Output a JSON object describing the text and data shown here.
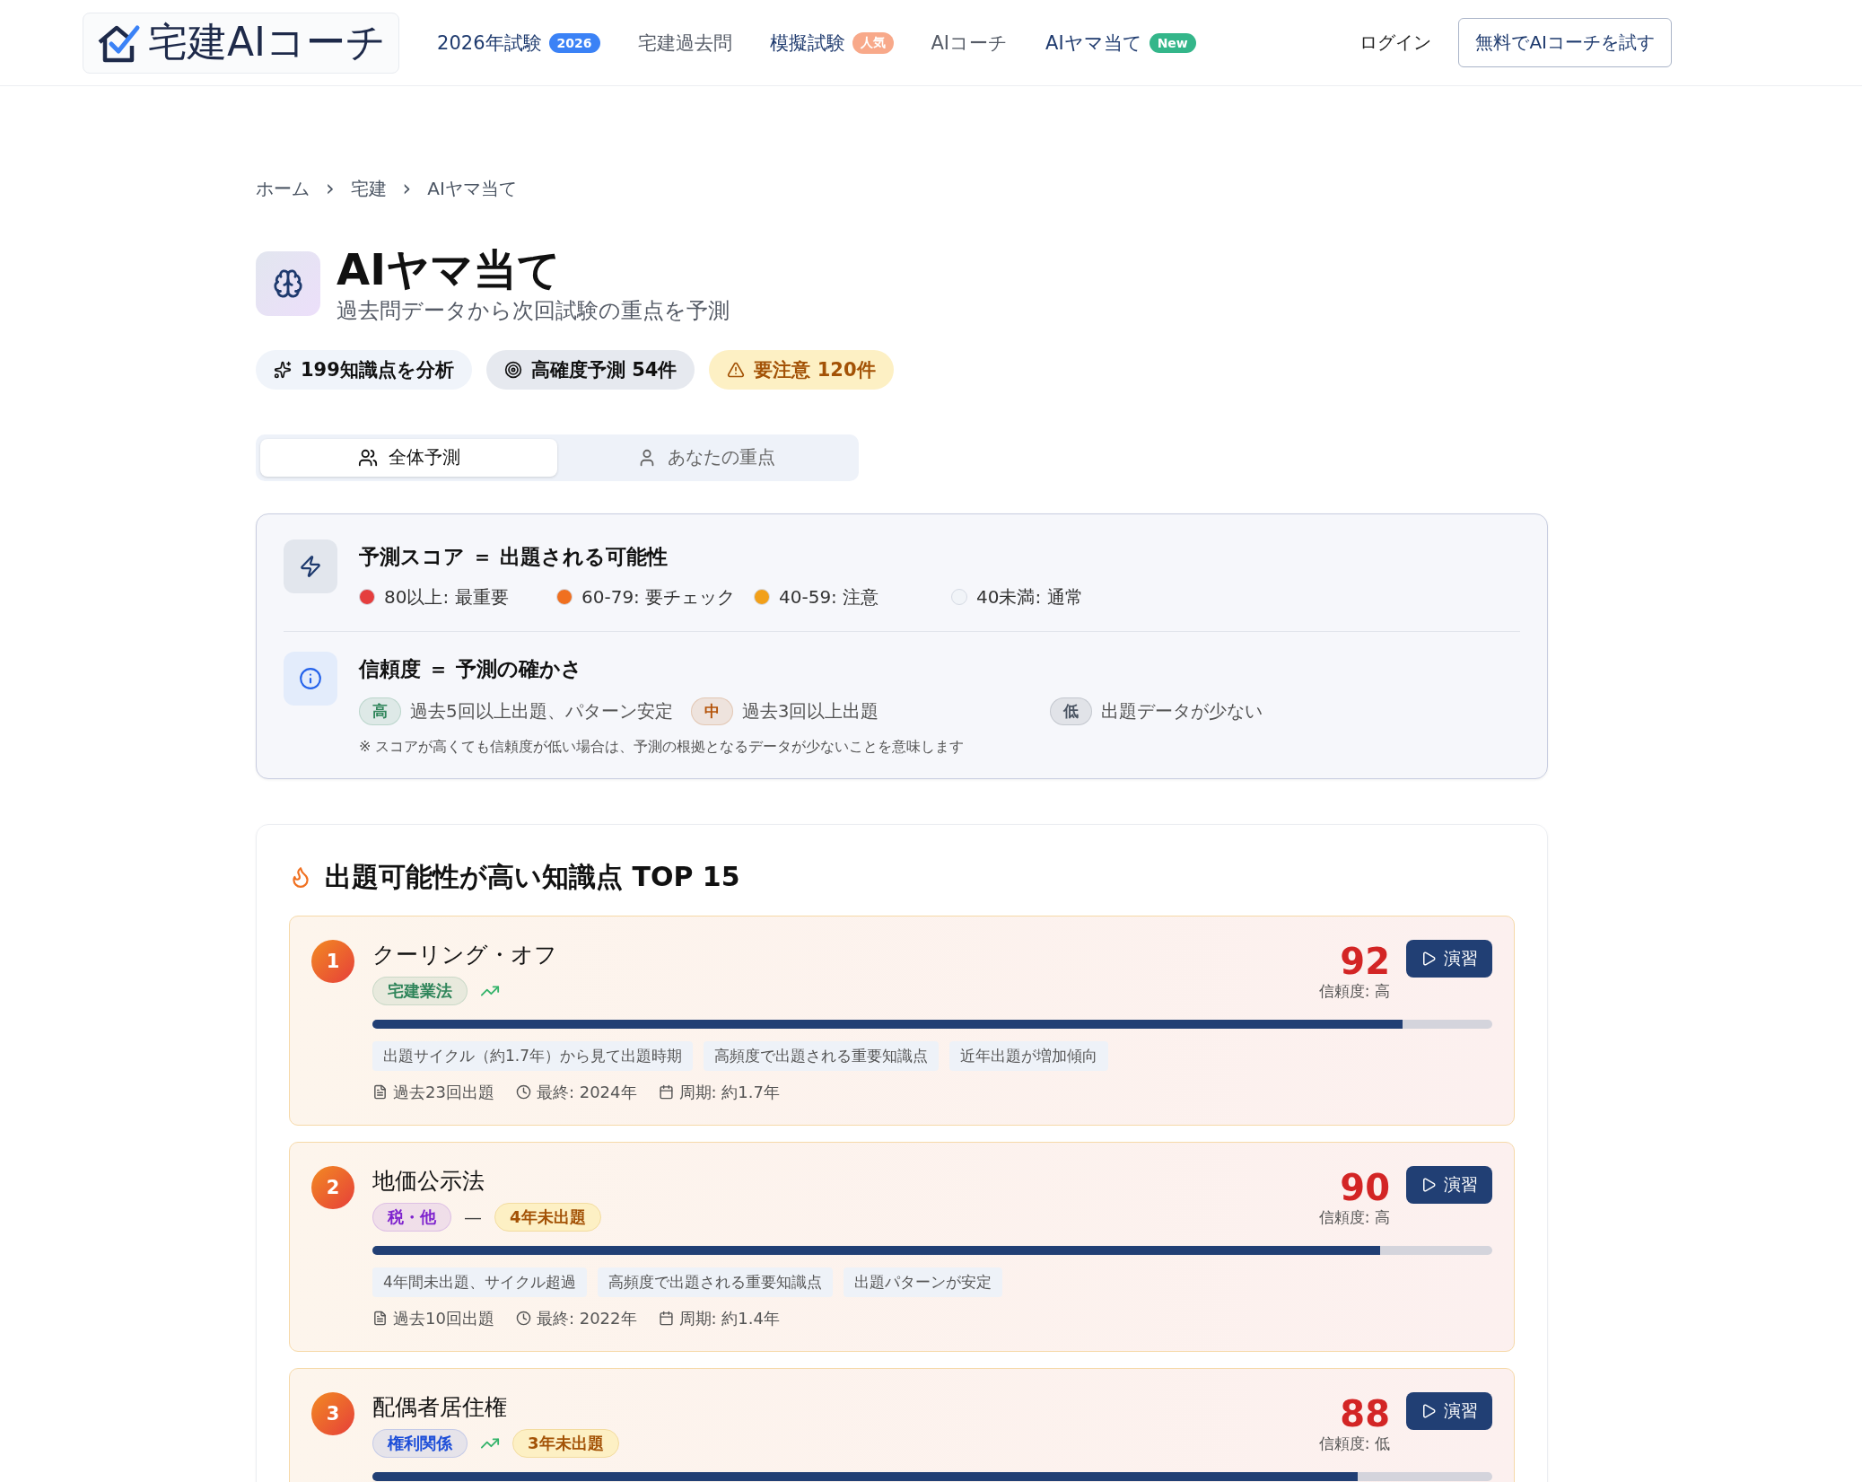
{
  "header": {
    "logo": "宅建AIコーチ",
    "nav": [
      {
        "label": "2026年試験",
        "badge": {
          "text": "2026",
          "color": "#3b82f6"
        },
        "kind": "featured"
      },
      {
        "label": "宅建過去問",
        "kind": "plain"
      },
      {
        "label": "模擬試験",
        "badge": {
          "text": "人気",
          "color": "#f8a98a"
        },
        "kind": "featured"
      },
      {
        "label": "AIコーチ",
        "kind": "plain"
      },
      {
        "label": "AIヤマ当て",
        "badge": {
          "text": "New",
          "color": "#34b68a"
        },
        "kind": "featured"
      }
    ],
    "login": "ログイン",
    "cta": "無料でAIコーチを試す"
  },
  "breadcrumb": [
    "ホーム",
    "宅建",
    "AIヤマ当て"
  ],
  "breadcrumb_separator": "›",
  "title": "AIヤマ当て",
  "subtitle": "過去問データから次回試験の重点を予測",
  "stats": [
    {
      "kind": "sparkle",
      "text": "199知識点を分析"
    },
    {
      "kind": "target",
      "text": "高確度予測 54件"
    },
    {
      "kind": "warning",
      "text": "要注意 120件"
    }
  ],
  "tabs": [
    {
      "kind": "group",
      "label": "全体予測",
      "selected": true
    },
    {
      "kind": "personal",
      "label": "あなたの重点",
      "selected": false
    }
  ],
  "legend": {
    "score_title": "予測スコア ＝ 出題される可能性",
    "score_levels": [
      {
        "text": "80以上: 最重要",
        "color": "#e53e3e"
      },
      {
        "text": "60-79: 要チェック",
        "color": "#f07020"
      },
      {
        "text": "40-59: 注意",
        "color": "#f2a01a"
      },
      {
        "text": "40未満: 通常",
        "color": "#f1f4f8"
      }
    ],
    "confidence_title": "信頼度 ＝ 予測の確かさ",
    "confidence_levels": [
      {
        "badge": "高",
        "text": "過去5回以上出題、パターン安定",
        "color": "#2f855a"
      },
      {
        "badge": "中",
        "text": "過去3回以上出題",
        "color": "#b45309"
      },
      {
        "badge": "低",
        "text": "出題データが少ない",
        "color": "#4b5563"
      }
    ],
    "note": "※ スコアが高くても信頼度が低い場合は、予測の根拠となるデータが少ないことを意味します"
  },
  "ranking": {
    "title": "出題可能性が高い知識点 TOP 15",
    "items": [
      {
        "rank": "1",
        "title": "クーリング・オフ",
        "category": {
          "text": "宅建業法",
          "color": "#2f855a"
        },
        "trend": {
          "kind": "up"
        },
        "score": "92",
        "confidence": "信頼度: 高",
        "level": 0.92,
        "action": "演習",
        "reasons": [
          "出題サイクル（約1.7年）から見て出題時期",
          "高頻度で出題される重要知識点",
          "近年出題が増加傾向"
        ],
        "meta": [
          {
            "kind": "file",
            "text": "過去23回出題"
          },
          {
            "kind": "clock",
            "text": "最終: 2024年"
          },
          {
            "kind": "calendar",
            "text": "周期: 約1.7年"
          }
        ]
      },
      {
        "rank": "2",
        "title": "地価公示法",
        "category": {
          "text": "税・他",
          "color": "#7e22ce"
        },
        "trend": {
          "kind": "flat",
          "text": "—"
        },
        "unseen": "4年未出題",
        "score": "90",
        "confidence": "信頼度: 高",
        "level": 0.9,
        "action": "演習",
        "reasons": [
          "4年間未出題、サイクル超過",
          "高頻度で出題される重要知識点",
          "出題パターンが安定"
        ],
        "meta": [
          {
            "kind": "file",
            "text": "過去10回出題"
          },
          {
            "kind": "clock",
            "text": "最終: 2022年"
          },
          {
            "kind": "calendar",
            "text": "周期: 約1.4年"
          }
        ]
      },
      {
        "rank": "3",
        "title": "配偶者居住権",
        "category": {
          "text": "権利関係",
          "color": "#1d4ed8"
        },
        "trend": {
          "kind": "up"
        },
        "unseen": "3年未出題",
        "score": "88",
        "confidence": "信頼度: 低",
        "level": 0.88,
        "action": "演習"
      }
    ]
  }
}
